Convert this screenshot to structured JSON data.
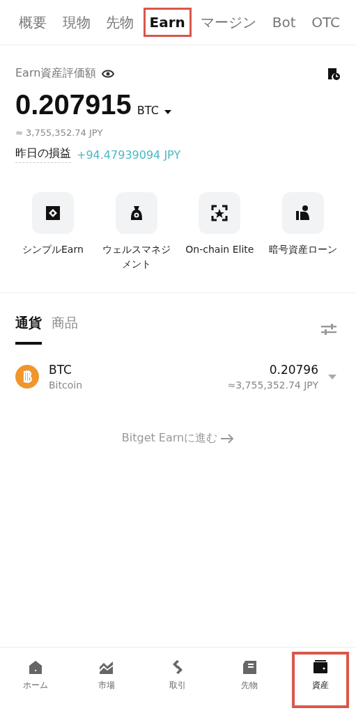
{
  "tabs": [
    {
      "label": "概要",
      "selected": false
    },
    {
      "label": "現物",
      "selected": false
    },
    {
      "label": "先物",
      "selected": false
    },
    {
      "label": "Earn",
      "selected": true
    },
    {
      "label": "マージン",
      "selected": false
    },
    {
      "label": "Bot",
      "selected": false
    },
    {
      "label": "OTC",
      "selected": false
    }
  ],
  "summary": {
    "title": "Earn資産評価額",
    "amount": "0.207915",
    "currency": "BTC",
    "fiat": "≈ 3,755,352.74 JPY",
    "pnl_label": "昨日の損益",
    "pnl_value": "+94.47939094 JPY"
  },
  "shortcuts": [
    {
      "kind": "simple",
      "label": "シンプルEarn"
    },
    {
      "kind": "wealth",
      "label": "ウェルスマネジメント"
    },
    {
      "kind": "elite",
      "label": "On-chain Elite"
    },
    {
      "kind": "loan",
      "label": "暗号資産ローン"
    }
  ],
  "subtabs": [
    {
      "label": "通貨",
      "selected": true
    },
    {
      "label": "商品",
      "selected": false
    }
  ],
  "assets": [
    {
      "symbol": "BTC",
      "name": "Bitcoin",
      "amount": "0.20796",
      "fiat": "≈3,755,352.74 JPY",
      "color": "#f0962e"
    }
  ],
  "link": "Bitget Earnに進む",
  "nav": [
    {
      "kind": "home",
      "label": "ホーム",
      "selected": false
    },
    {
      "kind": "market",
      "label": "市場",
      "selected": false
    },
    {
      "kind": "trade",
      "label": "取引",
      "selected": false
    },
    {
      "kind": "futures",
      "label": "先物",
      "selected": false
    },
    {
      "kind": "assets",
      "label": "資産",
      "selected": true
    }
  ]
}
